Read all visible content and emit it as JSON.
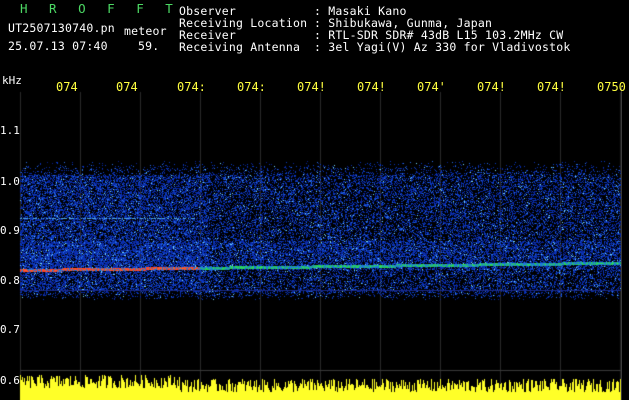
{
  "header": {
    "brand": "H R O F F T",
    "filename": "UT2507130740.pn",
    "mode": "meteor",
    "datetime": "25.07.13 07:40",
    "seconds": "59.",
    "fields": [
      {
        "label": "Observer",
        "value": ": Masaki Kano"
      },
      {
        "label": "Receiving Location",
        "value": ": Shibukawa, Gunma, Japan"
      },
      {
        "label": "Receiver",
        "value": ": RTL-SDR SDR# 43dB L15 103.2MHz CW"
      },
      {
        "label": "Receiving Antenna",
        "value": ": 3el Yagi(V) Az 330 for Vladivostok"
      }
    ]
  },
  "axis": {
    "unit": "kHz",
    "y_labels": [
      "1.1",
      "1.0",
      "0.9",
      "0.8",
      "0.7",
      "0.6"
    ],
    "time_labels": [
      "074",
      "074",
      "074:",
      "074:",
      "074!",
      "074!",
      "074'",
      "074!",
      "074!",
      "0750"
    ]
  },
  "colors": {
    "background": "#000000",
    "text": "#ffffff",
    "brand": "#4cd964",
    "ticks": "#ffff40",
    "signal": "#ff3030",
    "noise_base": "#0a1aa0"
  }
}
